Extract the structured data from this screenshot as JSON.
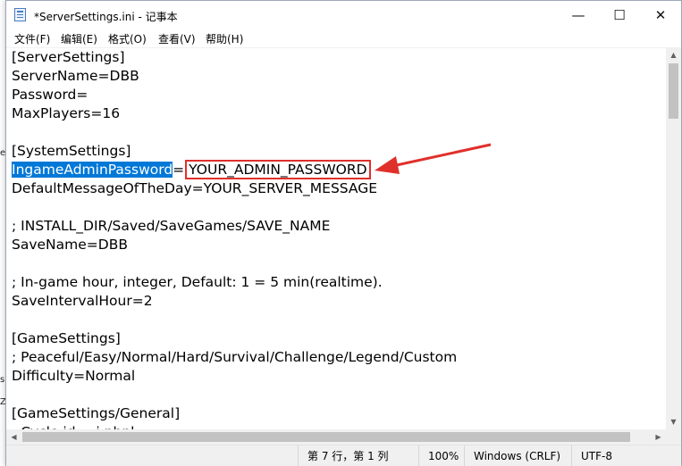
{
  "window": {
    "title": "*ServerSettings.ini - 记事本",
    "minimize": "—",
    "maximize": "☐",
    "close": "✕"
  },
  "menu": [
    "文件(F)",
    "编辑(E)",
    "格式(O)",
    "查看(V)",
    "帮助(H)"
  ],
  "lines": {
    "l1": "[ServerSettings]",
    "l2": "ServerName=DBB",
    "l3": "Password=",
    "l4": "MaxPlayers=16",
    "l6": "[SystemSettings]",
    "l7_selected": "IngameAdminPassword",
    "l7_eq": "=",
    "l7_value": "YOUR_ADMIN_PASSWORD",
    "l8": "DefaultMessageOfTheDay=YOUR_SERVER_MESSAGE",
    "l10": "; INSTALL_DIR/Saved/SaveGames/SAVE_NAME",
    "l11": "SaveName=DBB",
    "l13": "; In-game hour, integer, Default: 1 = 5 min(realtime).",
    "l14": "SaveIntervalHour=2",
    "l16": "[GameSettings]",
    "l17": "; Peaceful/Easy/Normal/Hard/Survival/Challenge/Legend/Custom",
    "l18": "Difficulty=Normal",
    "l20": "[GameSettings/General]",
    "l21": "; Cycle id = i nbpl ..."
  },
  "status": {
    "position": "第 7 行，第 1 列",
    "zoom": "100%",
    "line_ending": "Windows (CRLF)",
    "encoding": "UTF-8"
  },
  "desktop_fragments": {
    "f1": "e",
    "f2": "s)",
    "f3": "Z"
  },
  "colors": {
    "selection": "#0078d7",
    "annotation": "#e0302b"
  }
}
